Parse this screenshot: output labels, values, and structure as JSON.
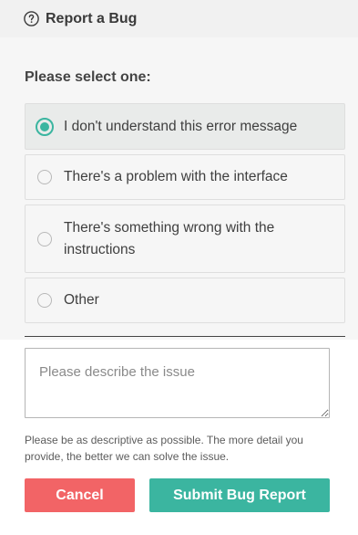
{
  "header": {
    "title": "Report a Bug",
    "icon": "help-circle-icon"
  },
  "form": {
    "prompt": "Please select one:",
    "options": [
      {
        "label": "I don't understand this error message",
        "selected": true
      },
      {
        "label": "There's a problem with the interface",
        "selected": false
      },
      {
        "label": "There's something wrong with the instructions",
        "selected": false
      },
      {
        "label": "Other",
        "selected": false
      }
    ],
    "description": {
      "value": "",
      "placeholder": "Please describe the issue"
    },
    "hint": "Please be as descriptive as possible. The more detail you provide, the better we can solve the issue."
  },
  "actions": {
    "cancel_label": "Cancel",
    "submit_label": "Submit Bug Report"
  },
  "colors": {
    "accent": "#3bb5a0",
    "danger": "#f26466",
    "header_bg": "#f1f1f1"
  }
}
